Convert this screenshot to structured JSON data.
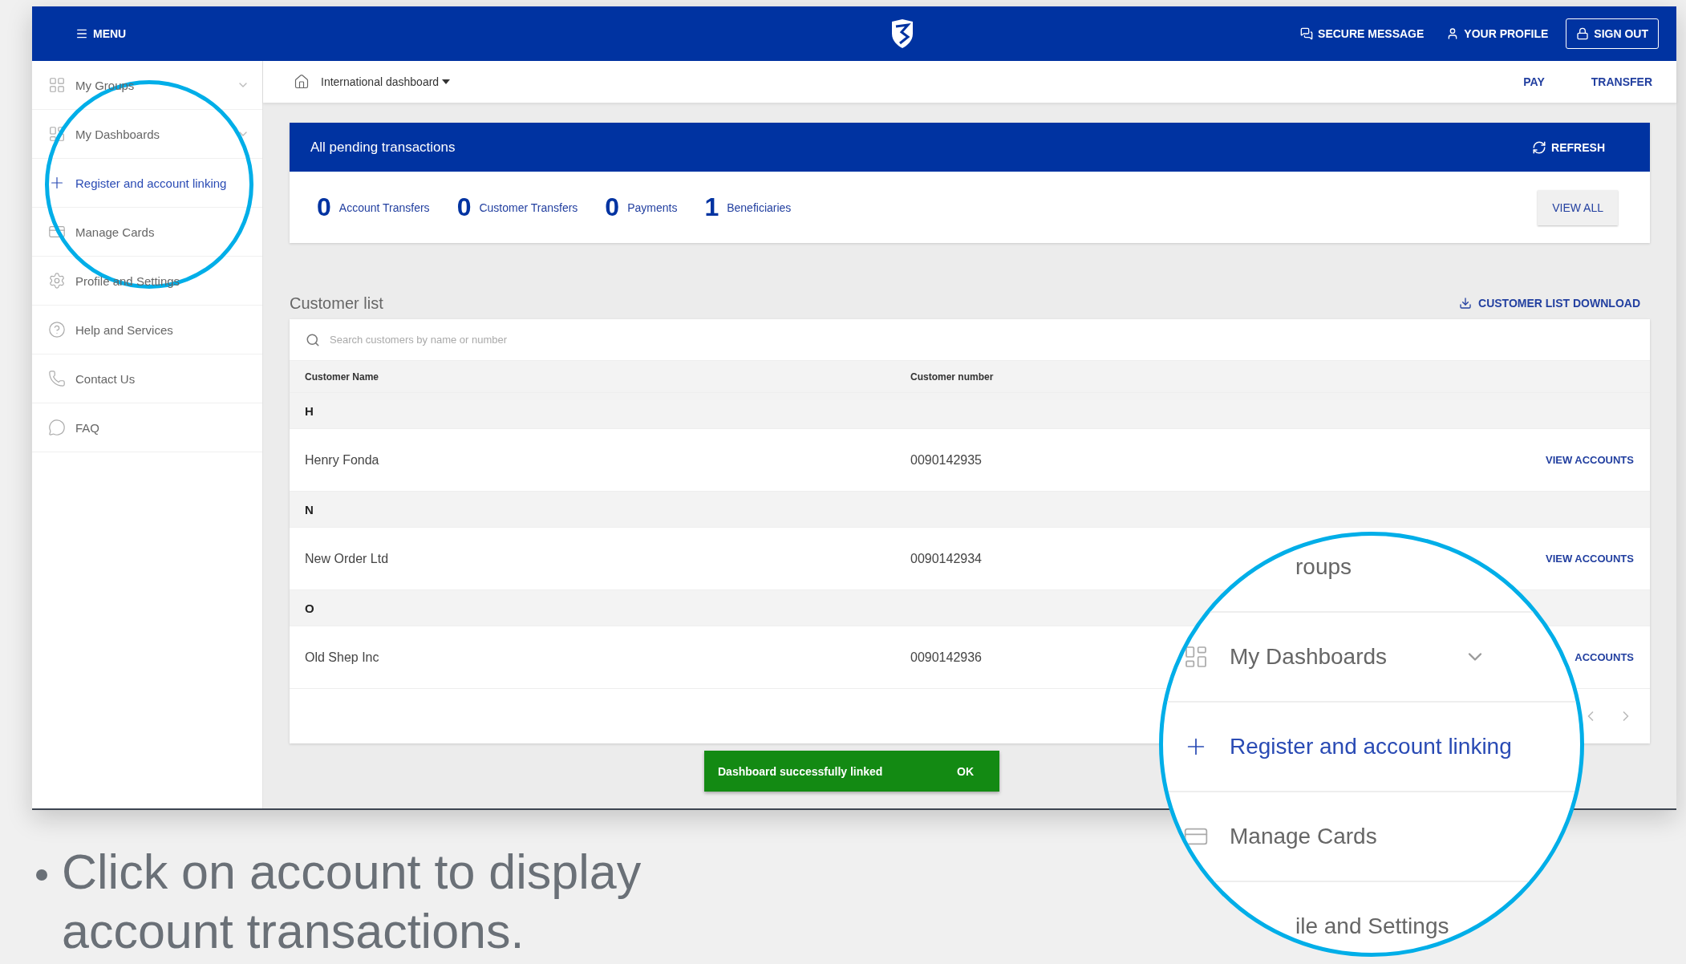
{
  "top_bar": {
    "menu": "MENU",
    "secure_message": "SECURE MESSAGE",
    "profile": "YOUR PROFILE",
    "sign_out": "SIGN OUT"
  },
  "sidebar": {
    "items": [
      {
        "kind": "groups",
        "label": "My Groups",
        "expandable": true,
        "selected": false
      },
      {
        "kind": "dashboards",
        "label": "My Dashboards",
        "expandable": true,
        "selected": false
      },
      {
        "kind": "link",
        "label": "Register and account linking",
        "expandable": false,
        "selected": true
      },
      {
        "kind": "cards",
        "label": "Manage Cards",
        "expandable": false,
        "selected": false
      },
      {
        "kind": "settings",
        "label": "Profile and Settings",
        "expandable": false,
        "selected": false
      },
      {
        "kind": "help",
        "label": "Help and Services",
        "expandable": false,
        "selected": false
      },
      {
        "kind": "contact",
        "label": "Contact Us",
        "expandable": false,
        "selected": false
      },
      {
        "kind": "faq",
        "label": "FAQ",
        "expandable": false,
        "selected": false
      }
    ]
  },
  "breadcrumb": {
    "dashboard": "International dashboard",
    "actions": [
      "PAY",
      "TRANSFER"
    ]
  },
  "pending": {
    "title": "All pending transactions",
    "refresh": "REFRESH",
    "view_all": "VIEW ALL",
    "counts": [
      {
        "value": "0",
        "label": "Account Transfers"
      },
      {
        "value": "0",
        "label": "Customer Transfers"
      },
      {
        "value": "0",
        "label": "Payments"
      },
      {
        "value": "1",
        "label": "Beneficiaries"
      }
    ]
  },
  "customer_list": {
    "title": "Customer list",
    "download": "CUSTOMER LIST DOWNLOAD",
    "search": {
      "placeholder": "Search customers by name or number"
    },
    "columns": [
      "Customer Name",
      "Customer number"
    ],
    "groups": [
      {
        "letter": "H",
        "rows": [
          {
            "name": "Henry Fonda",
            "number": "0090142935",
            "action": "VIEW ACCOUNTS"
          }
        ]
      },
      {
        "letter": "N",
        "rows": [
          {
            "name": "New Order Ltd",
            "number": "0090142934",
            "action": "VIEW ACCOUNTS"
          }
        ]
      },
      {
        "letter": "O",
        "rows": [
          {
            "name": "Old Shep Inc",
            "number": "0090142936",
            "action": "ACCOUNTS"
          }
        ]
      }
    ]
  },
  "toast": {
    "message": "Dashboard successfully linked",
    "action": "OK"
  },
  "magnifier": {
    "items": [
      {
        "label": "roups",
        "partial": true,
        "expandable": false,
        "selected": false
      },
      {
        "kind": "dashboards",
        "label": "My Dashboards",
        "partial": false,
        "expandable": true,
        "selected": false
      },
      {
        "kind": "link",
        "label": "Register and account linking",
        "partial": false,
        "expandable": false,
        "selected": true
      },
      {
        "kind": "cards",
        "label": "Manage Cards",
        "partial": false,
        "expandable": false,
        "selected": false
      },
      {
        "label": "ile and Settings",
        "partial": true,
        "expandable": false,
        "selected": false
      }
    ]
  },
  "caption": "Click on account to display account transactions."
}
